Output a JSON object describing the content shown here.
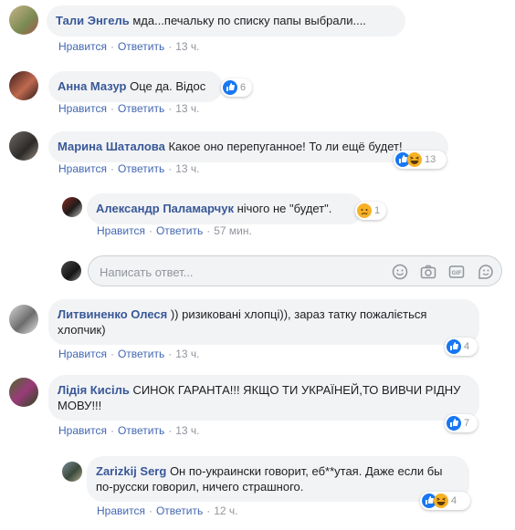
{
  "comments": [
    {
      "author": "Тали Энгель",
      "text": "мда...печальку по списку папы выбрали....",
      "like": "Нравится",
      "reply": "Ответить",
      "time": "13 ч."
    },
    {
      "author": "Анна Мазур",
      "text": "Оце да. Відос",
      "like": "Нравится",
      "reply": "Ответить",
      "time": "13 ч.",
      "reactions": "6"
    },
    {
      "author": "Марина Шаталова",
      "text": "Какое оно перепуганное! То ли ещё будет!",
      "like": "Нравится",
      "reply": "Ответить",
      "time": "13 ч.",
      "reactions": "13"
    },
    {
      "author": "Александр Паламарчук",
      "text": "нічого не \"будет\".",
      "like": "Нравится",
      "reply": "Ответить",
      "time": "57 мин.",
      "reactions": "1"
    },
    {
      "author": "Литвиненко Олеся",
      "text": ")) ризиковані хлопці)), зараз татку пожаліється хлопчик)",
      "like": "Нравится",
      "reply": "Ответить",
      "time": "13 ч.",
      "reactions": "4"
    },
    {
      "author": "Лідія Кисіль",
      "text": "СИНОК ГАРАНТА!!! ЯКЩО ТИ УКРАЇНЕЙ,ТО ВИВЧИ РІДНУ МОВУ!!!",
      "like": "Нравится",
      "reply": "Ответить",
      "time": "13 ч.",
      "reactions": "7"
    },
    {
      "author": "Zarizkij Serg",
      "text": "Он по-украински говорит, еб**утая. Даже если бы по-русски говорил, ничего страшного.",
      "like": "Нравится",
      "reply": "Ответить",
      "time": "12 ч.",
      "reactions": "4"
    }
  ],
  "reply_input": {
    "placeholder": "Написать ответ..."
  },
  "icons": [
    "emoji-icon",
    "camera-icon",
    "gif-icon",
    "sticker-icon",
    "like-reaction-icon",
    "haha-reaction-icon",
    "sad-reaction-icon"
  ],
  "colors": {
    "link": "#385898",
    "action": "#4267b2",
    "meta": "#90949c",
    "bubble": "#f2f3f5",
    "like_blue": "#1877f2",
    "haha_yellow": "#f7b125"
  }
}
